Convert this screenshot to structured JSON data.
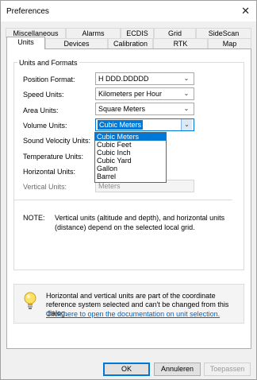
{
  "window": {
    "title": "Preferences",
    "close_glyph": "✕"
  },
  "tabs_row1": [
    "Miscellaneous",
    "Alarms",
    "ECDIS",
    "Grid",
    "SideScan"
  ],
  "tabs_row2": [
    "Units",
    "Devices",
    "Calibration",
    "RTK",
    "Map"
  ],
  "active_tab": "Units",
  "group": {
    "label": "Units and Formats"
  },
  "fields": [
    {
      "label": "Position Format:",
      "value": "H DDD.DDDDD",
      "state": "normal"
    },
    {
      "label": "Speed Units:",
      "value": "Kilometers per Hour",
      "state": "normal"
    },
    {
      "label": "Area Units:",
      "value": "Square Meters",
      "state": "normal"
    },
    {
      "label": "Volume Units:",
      "value": "Cubic Meters",
      "state": "open"
    },
    {
      "label": "Sound Velocity Units:",
      "value": "",
      "state": "hidden"
    },
    {
      "label": "Temperature Units:",
      "value": "",
      "state": "hidden"
    },
    {
      "label": "Horizontal Units:",
      "value": "",
      "state": "hidden"
    },
    {
      "label": "Vertical Units:",
      "value": "Meters",
      "state": "disabled"
    }
  ],
  "dropdown": {
    "options": [
      "Cubic Meters",
      "Cubic Feet",
      "Cubic Inch",
      "Cubic Yard",
      "Gallon",
      "Barrel"
    ],
    "selected": "Cubic Meters"
  },
  "note": {
    "label": "NOTE:",
    "text": "Vertical units (altitude and depth), and horizontal units (distance) depend on the selected local grid."
  },
  "info": {
    "text": "Horizontal and vertical units are part of the coordinate reference system selected and can't be changed from this dialog.",
    "link": "Click here to open the documentation on unit selection.",
    "icon": "lightbulb-icon"
  },
  "buttons": {
    "ok": "OK",
    "cancel": "Annuleren",
    "apply": "Toepassen"
  },
  "colors": {
    "accent": "#0078d7",
    "link": "#0066cc"
  }
}
